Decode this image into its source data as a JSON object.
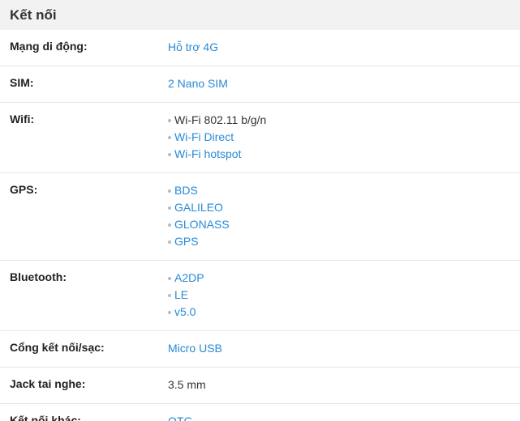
{
  "section": {
    "title": "Kết nối"
  },
  "colors": {
    "link": "#288ad6",
    "plain": "#333333",
    "header_bg": "#f2f2f2",
    "divider": "#e6e6e6"
  },
  "rows": [
    {
      "label": "Mạng di động:",
      "bulleted": false,
      "values": [
        {
          "text": "Hỗ trợ 4G",
          "link": true
        }
      ]
    },
    {
      "label": "SIM:",
      "bulleted": false,
      "values": [
        {
          "text": "2 Nano SIM",
          "link": true
        }
      ]
    },
    {
      "label": "Wifi:",
      "bulleted": true,
      "values": [
        {
          "text": "Wi-Fi 802.11 b/g/n",
          "link": false
        },
        {
          "text": "Wi-Fi Direct",
          "link": true
        },
        {
          "text": "Wi-Fi hotspot",
          "link": true
        }
      ]
    },
    {
      "label": "GPS:",
      "bulleted": true,
      "values": [
        {
          "text": "BDS",
          "link": true
        },
        {
          "text": "GALILEO",
          "link": true
        },
        {
          "text": "GLONASS",
          "link": true
        },
        {
          "text": "GPS",
          "link": true
        }
      ]
    },
    {
      "label": "Bluetooth:",
      "bulleted": true,
      "values": [
        {
          "text": "A2DP",
          "link": true
        },
        {
          "text": "LE",
          "link": true
        },
        {
          "text": "v5.0",
          "link": true
        }
      ]
    },
    {
      "label": "Cổng kết nối/sạc:",
      "bulleted": false,
      "values": [
        {
          "text": "Micro USB",
          "link": true
        }
      ]
    },
    {
      "label": "Jack tai nghe:",
      "bulleted": false,
      "values": [
        {
          "text": "3.5 mm",
          "link": false
        }
      ]
    },
    {
      "label": "Kết nối khác:",
      "bulleted": false,
      "values": [
        {
          "text": "OTG",
          "link": true
        }
      ]
    }
  ]
}
